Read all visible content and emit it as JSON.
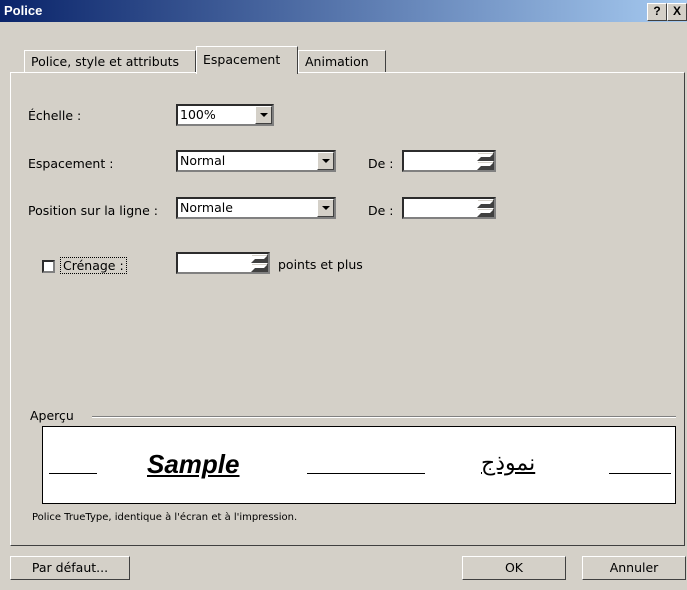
{
  "window": {
    "title": "Police",
    "help_btn": "?",
    "close_btn": "X"
  },
  "tabs": [
    {
      "label": "Police, style et attributs"
    },
    {
      "label": "Espacement"
    },
    {
      "label": "Animation"
    }
  ],
  "form": {
    "echelle_label": "Échelle :",
    "echelle_value": "100%",
    "espacement_label": "Espacement :",
    "espacement_value": "Normal",
    "espacement_de_label": "De :",
    "espacement_de_value": "",
    "position_label": "Position sur la ligne :",
    "position_value": "Normale",
    "position_de_label": "De :",
    "position_de_value": "",
    "crenage_label": "Crénage :",
    "crenage_checked": false,
    "crenage_value": "",
    "crenage_suffix": "points et plus"
  },
  "preview": {
    "title": "Aperçu",
    "sample_latin": "Sample",
    "sample_arabic": "نموذج",
    "note": "Police TrueType, identique à l'écran et à l'impression."
  },
  "buttons": {
    "default": "Par défaut...",
    "ok": "OK",
    "cancel": "Annuler"
  }
}
